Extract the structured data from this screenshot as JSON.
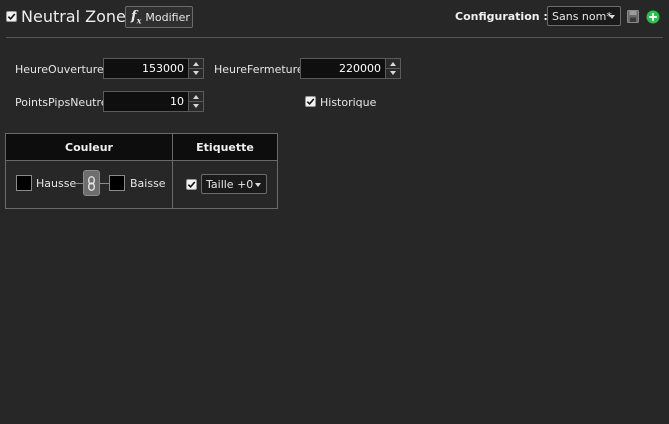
{
  "header": {
    "title": "Neutral Zone",
    "enabled": true,
    "modifier_label": "Modifier",
    "modifier_icon": "fx-icon",
    "configuration_label": "Configuration :",
    "configuration_value": "Sans nom*",
    "save_icon": "floppy-icon",
    "add_icon": "plus-circle-icon",
    "add_color": "#27c24a"
  },
  "params": {
    "heure_ouverture": {
      "label": "HeureOuverture",
      "value": "153000"
    },
    "heure_fermeture": {
      "label": "HeureFermeture",
      "value": "220000"
    },
    "points_pips_neutre": {
      "label": "PointsPipsNeutre",
      "value": "10"
    },
    "historique": {
      "label": "Historique",
      "checked": true
    }
  },
  "style_table": {
    "headers": {
      "couleur": "Couleur",
      "etiquette": "Etiquette"
    },
    "hausse": {
      "label": "Hausse",
      "color": "#000000"
    },
    "baisse": {
      "label": "Baisse",
      "color": "#000000"
    },
    "link_icon": "chain-link-icon",
    "etiquette": {
      "checked": true,
      "size_value": "Taille +0"
    }
  }
}
